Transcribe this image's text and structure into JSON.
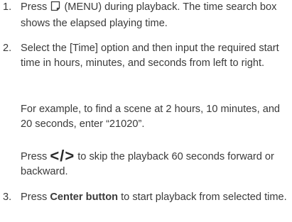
{
  "steps": [
    {
      "number": "1.",
      "before_icon": "Press",
      "icon": "menu-icon",
      "after_icon": "(MENU) during playback. The time search box shows the elapsed playing time."
    },
    {
      "number": "2.",
      "text": "Select the [Time] option and then input the required start time in hours, minutes, and seconds from left to right.",
      "example": "For example, to find a scene at 2 hours, 10 minutes, and 20 seconds, enter “21020”.",
      "skip_before": "Press",
      "skip_symbols": "</>",
      "skip_after": "to skip the playback 60 seconds forward or backward."
    },
    {
      "number": "3.",
      "before_bold": "Press",
      "bold": "Center button",
      "after_bold": "to start playback from selected time."
    }
  ]
}
